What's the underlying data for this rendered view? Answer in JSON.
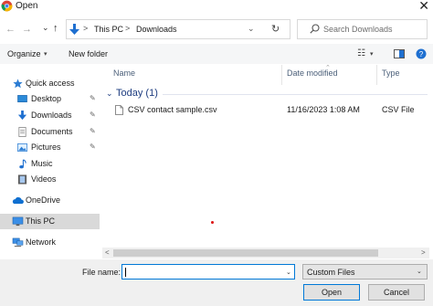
{
  "window": {
    "title": "Open",
    "close_glyph": "✕"
  },
  "nav_buttons": {
    "back": "←",
    "forward": "→",
    "dropdown": "⌄",
    "up": "↑"
  },
  "address": {
    "crumbs": [
      "This PC",
      "Downloads"
    ],
    "separator": ">",
    "dropdown": "⌄",
    "refresh": "↻"
  },
  "search": {
    "placeholder": "Search Downloads"
  },
  "toolbar": {
    "organize_label": "Organize",
    "organize_caret": "▾",
    "new_folder_label": "New folder",
    "view_icon": "☷",
    "view_caret": "▾",
    "help": "?"
  },
  "sidebar": {
    "items": [
      {
        "label": "Quick access",
        "icon": "star-icon",
        "pinned": false
      },
      {
        "label": "Desktop",
        "icon": "desktop-folder-icon",
        "pinned": true
      },
      {
        "label": "Downloads",
        "icon": "download-folder-icon",
        "pinned": true
      },
      {
        "label": "Documents",
        "icon": "documents-folder-icon",
        "pinned": true
      },
      {
        "label": "Pictures",
        "icon": "pictures-folder-icon",
        "pinned": true
      },
      {
        "label": "Music",
        "icon": "music-folder-icon",
        "pinned": false
      },
      {
        "label": "Videos",
        "icon": "videos-folder-icon",
        "pinned": false
      },
      {
        "label": "OneDrive",
        "icon": "cloud-icon",
        "pinned": false
      },
      {
        "label": "This PC",
        "icon": "computer-icon",
        "pinned": false,
        "selected": true
      },
      {
        "label": "Network",
        "icon": "network-icon",
        "pinned": false
      }
    ],
    "pin_glyph": "📌",
    "chevron": "›"
  },
  "columns": {
    "name": "Name",
    "date": "Date modified",
    "type": "Type"
  },
  "groups": [
    {
      "label": "Today (1)",
      "chevron": "⌄",
      "files": [
        {
          "name": "CSV contact sample.csv",
          "date": "11/16/2023 1:08 AM",
          "type": "CSV File"
        }
      ]
    }
  ],
  "scrollbar": {
    "left": "<",
    "right": ">"
  },
  "footer": {
    "file_name_label": "File name:",
    "file_name_value": "",
    "filter_value": "Custom Files",
    "dropdown": "⌄",
    "open_label": "Open",
    "cancel_label": "Cancel"
  },
  "colors": {
    "accent": "#0078d7",
    "group_text": "#1e3d80",
    "selected_bg": "#d9d9d9"
  }
}
